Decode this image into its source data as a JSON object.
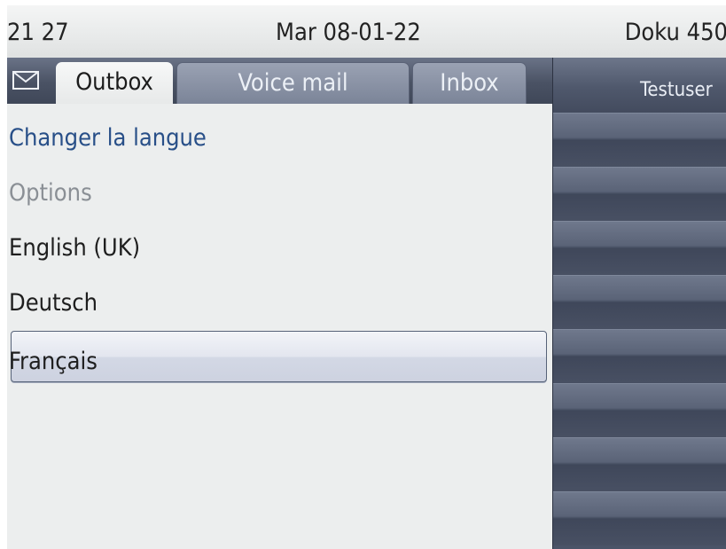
{
  "statusbar": {
    "time": "21 27",
    "date": "Mar 08-01-22",
    "user": "Doku 450"
  },
  "tabs": {
    "icon": "envelope-icon",
    "outbox": "Outbox",
    "voice_mail": "Voice mail",
    "inbox": "Inbox",
    "active": "Outbox"
  },
  "menu": {
    "title": "Changer la langue",
    "section_label": "Options",
    "items": [
      "English (UK)",
      "Deutsch",
      "Français"
    ],
    "selected": "Français"
  },
  "side_panel": {
    "title": "Testuser"
  },
  "colors": {
    "header_text": "#284f88",
    "panel_bg": "#4b5468",
    "selection_border": "#566278"
  }
}
